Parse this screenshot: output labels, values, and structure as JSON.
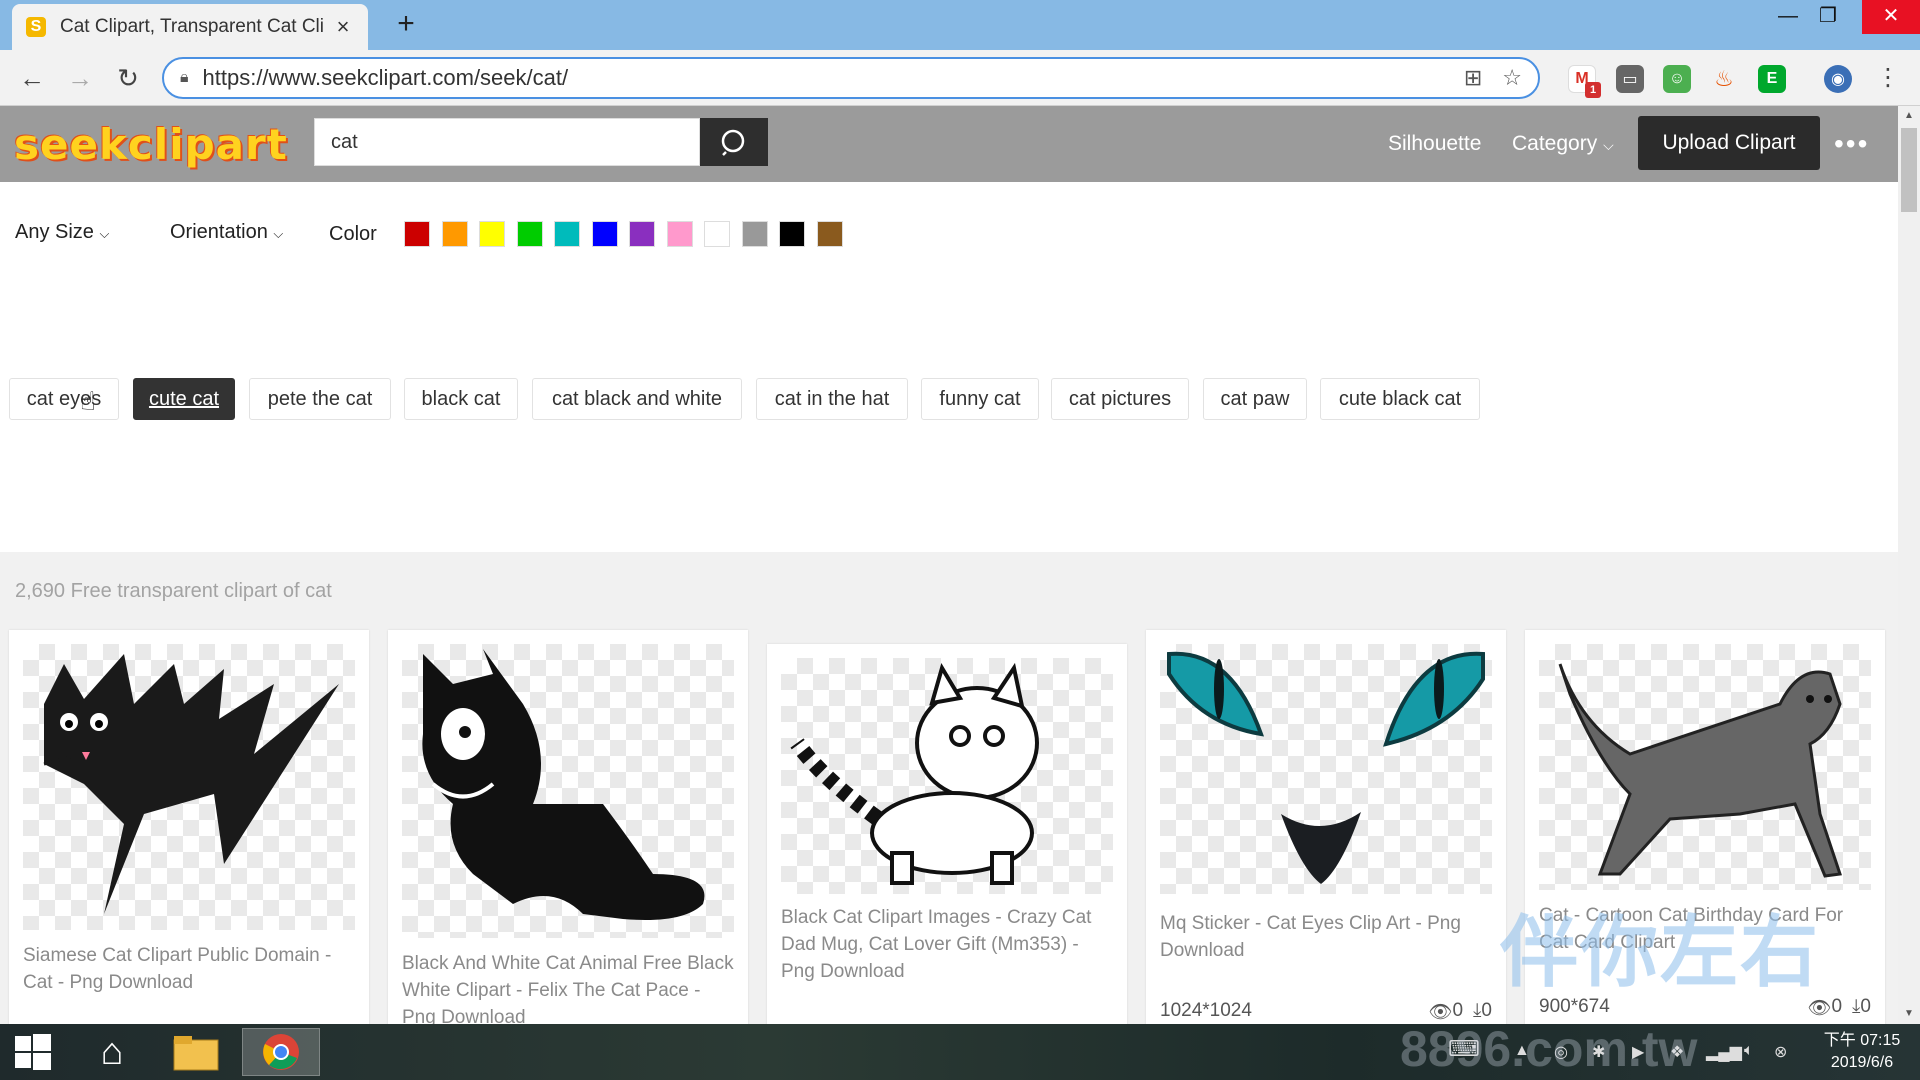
{
  "browser": {
    "tab_title": "Cat Clipart, Transparent Cat Cli",
    "tab_favicon": "S",
    "new_tab": "+",
    "url": "https://www.seekclipart.com/seek/cat/",
    "gmail_badge": "1"
  },
  "site": {
    "logo": "seekclipart",
    "search_value": "cat",
    "nav": {
      "silhouette": "Silhouette",
      "category": "Category",
      "upload": "Upload Clipart"
    }
  },
  "filters": {
    "size": "Any Size",
    "orientation": "Orientation",
    "color": "Color",
    "swatches": [
      "#cc0000",
      "#ff9900",
      "#ffff00",
      "#00cc00",
      "#00bbbb",
      "#0000ff",
      "#8a2fbf",
      "#ff99cc",
      "#ffffff",
      "#999999",
      "#000000",
      "#8a5a1e"
    ]
  },
  "tags": [
    "cat eyes",
    "cute cat",
    "pete the cat",
    "black cat",
    "cat black and white",
    "cat in the hat",
    "funny cat",
    "cat pictures",
    "cat paw",
    "cute black cat"
  ],
  "results": {
    "count": "2,690 Free transparent clipart of cat",
    "cards": [
      {
        "title": "Siamese Cat Clipart Public Domain - Cat - Png Download",
        "dims": "",
        "views": "",
        "downloads": ""
      },
      {
        "title": "Black And White Cat Animal Free Black White Clipart - Felix The Cat Pace - Png Download",
        "dims": "",
        "views": "",
        "downloads": ""
      },
      {
        "title": "Black Cat Clipart Images - Crazy Cat Dad Mug, Cat Lover Gift (Mm353) - Png Download",
        "dims": "",
        "views": "",
        "downloads": ""
      },
      {
        "title": "Mq Sticker - Cat Eyes Clip Art - Png Download",
        "dims": "1024*1024",
        "views": "0",
        "downloads": "0"
      },
      {
        "title": "Cat - Cartoon Cat Birthday Card For Cat Card Clipart",
        "dims": "900*674",
        "views": "0",
        "downloads": "0"
      }
    ]
  },
  "taskbar": {
    "time": "下午 07:15",
    "date": "2019/6/6"
  },
  "watermark": {
    "text": "伴你左右",
    "site": "8896.com.tw"
  }
}
